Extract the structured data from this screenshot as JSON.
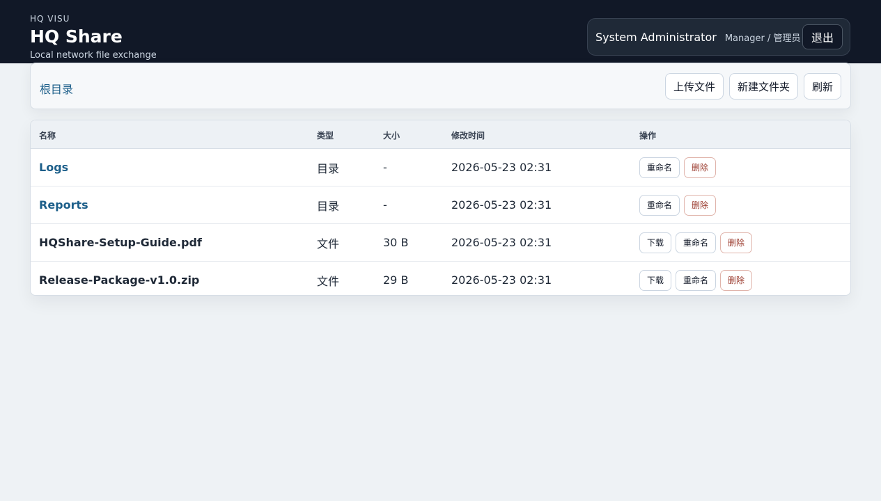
{
  "header": {
    "kicker": "HQ VISU",
    "title": "HQ Share",
    "subtitle": "Local network file exchange",
    "user_name": "System Administrator",
    "user_role": "Manager / 管理员",
    "logout_label": "退出"
  },
  "toolbar": {
    "breadcrumb": "根目录",
    "upload_label": "上传文件",
    "new_folder_label": "新建文件夹",
    "refresh_label": "刷新"
  },
  "table": {
    "columns": [
      "名称",
      "类型",
      "大小",
      "修改时间",
      "操作"
    ],
    "rows": [
      {
        "name": "Logs",
        "type": "目录",
        "size": "-",
        "modified": "2026-05-23 02:31",
        "is_dir": true
      },
      {
        "name": "Reports",
        "type": "目录",
        "size": "-",
        "modified": "2026-05-23 02:31",
        "is_dir": true
      },
      {
        "name": "HQShare-Setup-Guide.pdf",
        "type": "文件",
        "size": "30 B",
        "modified": "2026-05-23 02:31",
        "is_dir": false
      },
      {
        "name": "Release-Package-v1.0.zip",
        "type": "文件",
        "size": "29 B",
        "modified": "2026-05-23 02:31",
        "is_dir": false
      }
    ],
    "actions": {
      "download": "下载",
      "rename": "重命名",
      "delete": "删除"
    }
  },
  "colors": {
    "header_bg": "#111827",
    "page_bg": "#eef2f5",
    "link": "#1d5f8a",
    "danger": "#9b3b2e"
  }
}
